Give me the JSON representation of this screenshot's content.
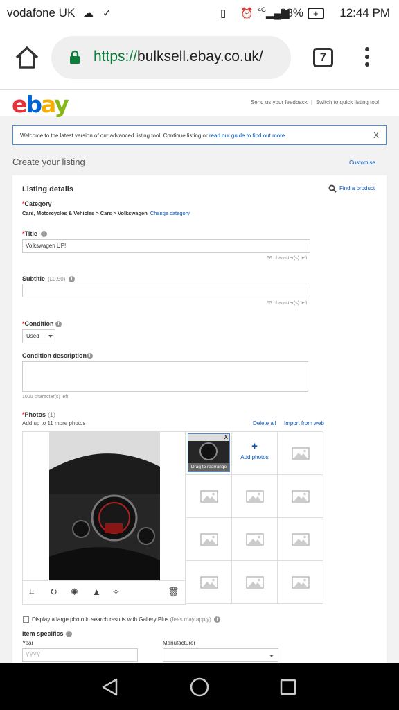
{
  "status_bar": {
    "carrier": "vodafone UK",
    "network": "4G",
    "battery": "88%",
    "time": "12:44 PM"
  },
  "browser": {
    "url_scheme": "https://",
    "url_domain": "bulksell.ebay.co.uk/",
    "tab_count": "7"
  },
  "header": {
    "logo": [
      "e",
      "b",
      "a",
      "y"
    ],
    "feedback_link": "Send us your feedback",
    "quick_tool_link": "Switch to quick listing tool"
  },
  "banner": {
    "text": "Welcome to the latest version of our advanced listing tool. Continue listing or ",
    "link": "read our guide to find out more",
    "close": "X"
  },
  "page": {
    "title": "Create your listing",
    "customise": "Customise"
  },
  "listing": {
    "title": "Listing details",
    "find_product": "Find a product",
    "category": {
      "required_mark": "*",
      "label": "Category",
      "path": "Cars, Motorcycles & Vehicles > Cars > Volkswagen",
      "change": "Change category"
    },
    "title_field": {
      "required_mark": "*",
      "label": "Title",
      "value": "Volkswagen UP!",
      "remaining": "66 character(s) left"
    },
    "subtitle": {
      "label": "Subtitle",
      "fee": "(£0.50)",
      "value": "",
      "remaining": "55 character(s) left"
    },
    "condition": {
      "required_mark": "*",
      "label": "Condition",
      "value": "Used"
    },
    "condition_description": {
      "label": "Condition description",
      "value": "",
      "remaining": "1000 character(s) left"
    },
    "photos": {
      "required_mark": "*",
      "label": "Photos",
      "count": "(1)",
      "hint": "Add up to 11 more photos",
      "delete_all": "Delete all",
      "import": "Import from web",
      "drag_label": "Drag to rearrange",
      "thumb_close": "X",
      "add_photos": "Add photos",
      "add_icon": "+"
    },
    "gallery_plus": {
      "text": "Display a large photo in search results with Gallery Plus",
      "fees": "(fees may apply)"
    },
    "item_specifics": {
      "label": "Item specifics",
      "year_label": "Year",
      "year_placeholder": "YYYY",
      "manufacturer_label": "Manufacturer"
    }
  },
  "icons": [
    "home-icon",
    "lock-icon",
    "menu-icon",
    "search-icon",
    "info-icon",
    "crop-icon",
    "rotate-icon",
    "brightness-icon",
    "contrast-icon",
    "auto-enhance-icon",
    "trash-icon",
    "back-icon",
    "home-circle-icon",
    "recents-icon"
  ]
}
